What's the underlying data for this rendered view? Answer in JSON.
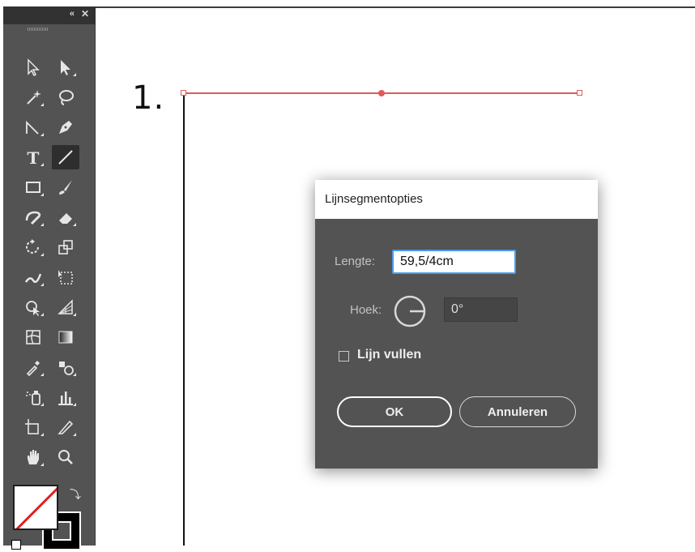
{
  "toolbar": {
    "collapse_glyph": "«",
    "close_glyph": "✕",
    "tools": [
      {
        "name": "selection-tool-icon"
      },
      {
        "name": "direct-selection-tool-icon"
      },
      {
        "name": "magic-wand-tool-icon"
      },
      {
        "name": "lasso-tool-icon"
      },
      {
        "name": "curvature-tool-icon"
      },
      {
        "name": "pen-tool-icon"
      },
      {
        "name": "type-tool-icon"
      },
      {
        "name": "line-segment-tool-icon",
        "active": true
      },
      {
        "name": "rectangle-tool-icon"
      },
      {
        "name": "paintbrush-tool-icon"
      },
      {
        "name": "shaper-tool-icon"
      },
      {
        "name": "eraser-tool-icon"
      },
      {
        "name": "rotate-tool-icon"
      },
      {
        "name": "scale-tool-icon"
      },
      {
        "name": "warp-tool-icon"
      },
      {
        "name": "free-transform-tool-icon"
      },
      {
        "name": "shape-builder-tool-icon"
      },
      {
        "name": "perspective-grid-tool-icon"
      },
      {
        "name": "mesh-tool-icon"
      },
      {
        "name": "gradient-tool-icon"
      },
      {
        "name": "eyedropper-tool-icon"
      },
      {
        "name": "blend-tool-icon"
      },
      {
        "name": "symbol-sprayer-tool-icon"
      },
      {
        "name": "column-graph-tool-icon"
      },
      {
        "name": "artboard-tool-icon"
      },
      {
        "name": "slice-tool-icon"
      },
      {
        "name": "hand-tool-icon"
      },
      {
        "name": "zoom-tool-icon"
      }
    ],
    "fill_color": "none",
    "stroke_color": "#000000"
  },
  "canvas": {
    "step_label": "1.",
    "line_color": "#e05b5b"
  },
  "dialog": {
    "title": "Lijnsegmentopties",
    "length_label": "Lengte:",
    "length_value": "59,5/4cm",
    "angle_label": "Hoek:",
    "angle_value": "0°",
    "fill_line_label": "Lijn vullen",
    "fill_line_checked": false,
    "ok_label": "OK",
    "cancel_label": "Annuleren"
  }
}
